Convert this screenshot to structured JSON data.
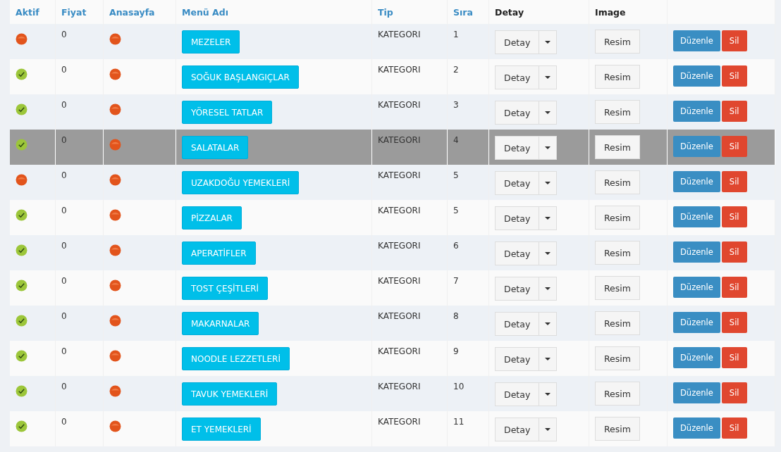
{
  "columns": [
    "Aktif",
    "Fiyat",
    "Anasayfa",
    "Menü Adı",
    "Tip",
    "Sıra",
    "Detay",
    "Image"
  ],
  "rows": [
    {
      "active": false,
      "price": "0",
      "homepage": false,
      "name": "MEZELER",
      "type": "KATEGORI",
      "order": "1",
      "detail": "Detay",
      "image": "Resim",
      "edit": "Düzenle",
      "delete": "Sil",
      "selected": false
    },
    {
      "active": true,
      "price": "0",
      "homepage": false,
      "name": "SOĞUK BAŞLANGIÇLAR",
      "type": "KATEGORI",
      "order": "2",
      "detail": "Detay",
      "image": "Resim",
      "edit": "Düzenle",
      "delete": "Sil",
      "selected": false
    },
    {
      "active": true,
      "price": "0",
      "homepage": false,
      "name": "YÖRESEL TATLAR",
      "type": "KATEGORI",
      "order": "3",
      "detail": "Detay",
      "image": "Resim",
      "edit": "Düzenle",
      "delete": "Sil",
      "selected": false
    },
    {
      "active": true,
      "price": "0",
      "homepage": false,
      "name": "SALATALAR",
      "type": "KATEGORI",
      "order": "4",
      "detail": "Detay",
      "image": "Resim",
      "edit": "Düzenle",
      "delete": "Sil",
      "selected": true
    },
    {
      "active": false,
      "price": "0",
      "homepage": false,
      "name": "UZAKDOĞU YEMEKLERİ",
      "type": "KATEGORI",
      "order": "5",
      "detail": "Detay",
      "image": "Resim",
      "edit": "Düzenle",
      "delete": "Sil",
      "selected": false
    },
    {
      "active": true,
      "price": "0",
      "homepage": false,
      "name": "PİZZALAR",
      "type": "KATEGORI",
      "order": "5",
      "detail": "Detay",
      "image": "Resim",
      "edit": "Düzenle",
      "delete": "Sil",
      "selected": false
    },
    {
      "active": true,
      "price": "0",
      "homepage": false,
      "name": "APERATİFLER",
      "type": "KATEGORI",
      "order": "6",
      "detail": "Detay",
      "image": "Resim",
      "edit": "Düzenle",
      "delete": "Sil",
      "selected": false
    },
    {
      "active": true,
      "price": "0",
      "homepage": false,
      "name": "TOST ÇEŞİTLERİ",
      "type": "KATEGORI",
      "order": "7",
      "detail": "Detay",
      "image": "Resim",
      "edit": "Düzenle",
      "delete": "Sil",
      "selected": false
    },
    {
      "active": true,
      "price": "0",
      "homepage": false,
      "name": "MAKARNALAR",
      "type": "KATEGORI",
      "order": "8",
      "detail": "Detay",
      "image": "Resim",
      "edit": "Düzenle",
      "delete": "Sil",
      "selected": false
    },
    {
      "active": true,
      "price": "0",
      "homepage": false,
      "name": "NOODLE LEZZETLERİ",
      "type": "KATEGORI",
      "order": "9",
      "detail": "Detay",
      "image": "Resim",
      "edit": "Düzenle",
      "delete": "Sil",
      "selected": false
    },
    {
      "active": true,
      "price": "0",
      "homepage": false,
      "name": "TAVUK YEMEKLERİ",
      "type": "KATEGORI",
      "order": "10",
      "detail": "Detay",
      "image": "Resim",
      "edit": "Düzenle",
      "delete": "Sil",
      "selected": false
    },
    {
      "active": true,
      "price": "0",
      "homepage": false,
      "name": "ET YEMEKLERİ",
      "type": "KATEGORI",
      "order": "11",
      "detail": "Detay",
      "image": "Resim",
      "edit": "Düzenle",
      "delete": "Sil",
      "selected": false
    }
  ]
}
